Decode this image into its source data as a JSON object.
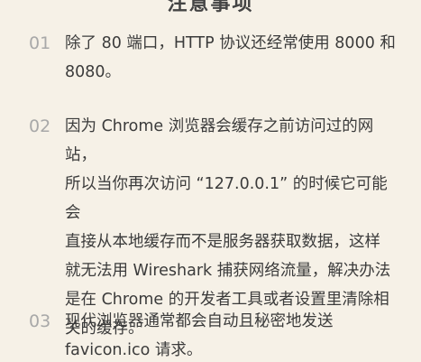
{
  "header": {
    "title": "注意事项"
  },
  "notes": [
    {
      "number": "01",
      "text": "除了 80 端口，HTTP 协议还经常使用 8000 和\n8080。"
    },
    {
      "number": "02",
      "text": "因为 Chrome 浏览器会缓存之前访问过的网站，\n所以当你再次访问 “127.0.0.1” 的时候它可能会\n直接从本地缓存而不是服务器获取数据，这样\n就无法用 Wireshark 捕获网络流量，解决办法\n是在 Chrome 的开发者工具或者设置里清除相\n关的缓存。"
    },
    {
      "number": "03",
      "text": "现代浏览器通常都会自动且秘密地发送\nfavicon.ico 请求。"
    }
  ]
}
